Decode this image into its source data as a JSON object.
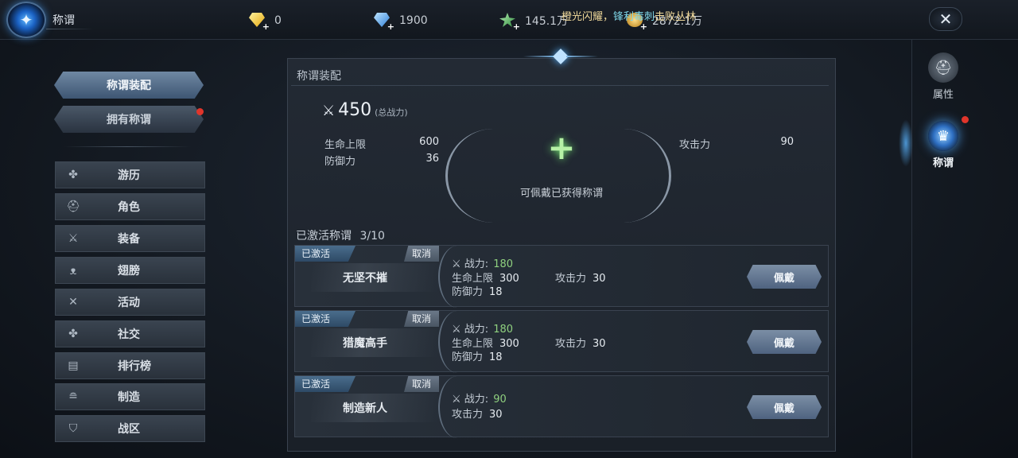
{
  "header": {
    "title": "称谓",
    "close_icon": "close-icon",
    "currencies": [
      {
        "icon": "yellow-diamond-icon",
        "value": "0"
      },
      {
        "icon": "blue-diamond-icon",
        "value": "1900"
      },
      {
        "icon": "green-star-icon",
        "value": "145.1万"
      },
      {
        "icon": "gold-coin-icon",
        "value": "2872.1万"
      }
    ],
    "broadcast": {
      "part1": "橙光闪耀，",
      "part2": "锋利毒刺",
      "part3": "击败丛林"
    }
  },
  "sidebar": {
    "tabs": [
      {
        "label": "称谓装配",
        "active": true
      },
      {
        "label": "拥有称谓",
        "active": false,
        "red_dot": true
      }
    ],
    "menu": [
      {
        "label": "游历",
        "icon": "puzzle-icon"
      },
      {
        "label": "角色",
        "icon": "helmet-icon"
      },
      {
        "label": "装备",
        "icon": "equipment-icon"
      },
      {
        "label": "翅膀",
        "icon": "wings-icon"
      },
      {
        "label": "活动",
        "icon": "crossed-swords-icon"
      },
      {
        "label": "社交",
        "icon": "puzzle-icon"
      },
      {
        "label": "排行榜",
        "icon": "trophy-icon"
      },
      {
        "label": "制造",
        "icon": "anvil-icon"
      },
      {
        "label": "战区",
        "icon": "shield-icon"
      }
    ]
  },
  "panel": {
    "title": "称谓装配",
    "total_power": "450",
    "total_power_label": "(总战力)",
    "stats_left": [
      {
        "label": "生命上限",
        "value": "600"
      },
      {
        "label": "防御力",
        "value": "36"
      }
    ],
    "stats_right": [
      {
        "label": "攻击力",
        "value": "90"
      }
    ],
    "equip_hint": "可佩戴已获得称谓",
    "active_count_label": "已激活称谓",
    "active_count": "3/10",
    "cards": [
      {
        "badge": "已激活",
        "cancel": "取消",
        "name": "无坚不摧",
        "power_label": "战力:",
        "power": "180",
        "stats": [
          {
            "label": "生命上限",
            "value": "300"
          },
          {
            "label": "攻击力",
            "value": "30"
          },
          {
            "label": "防御力",
            "value": "18"
          }
        ],
        "wear": "佩戴"
      },
      {
        "badge": "已激活",
        "cancel": "取消",
        "name": "猎魔高手",
        "power_label": "战力:",
        "power": "180",
        "stats": [
          {
            "label": "生命上限",
            "value": "300"
          },
          {
            "label": "攻击力",
            "value": "30"
          },
          {
            "label": "防御力",
            "value": "18"
          }
        ],
        "wear": "佩戴"
      },
      {
        "badge": "已激活",
        "cancel": "取消",
        "name": "制造新人",
        "power_label": "战力:",
        "power": "90",
        "stats": [
          {
            "label": "攻击力",
            "value": "30"
          }
        ],
        "wear": "佩戴"
      }
    ]
  },
  "right_rail": [
    {
      "label": "属性",
      "icon": "helmet-icon"
    },
    {
      "label": "称谓",
      "icon": "title-emblem-icon",
      "active": true,
      "red_dot": true
    }
  ]
}
